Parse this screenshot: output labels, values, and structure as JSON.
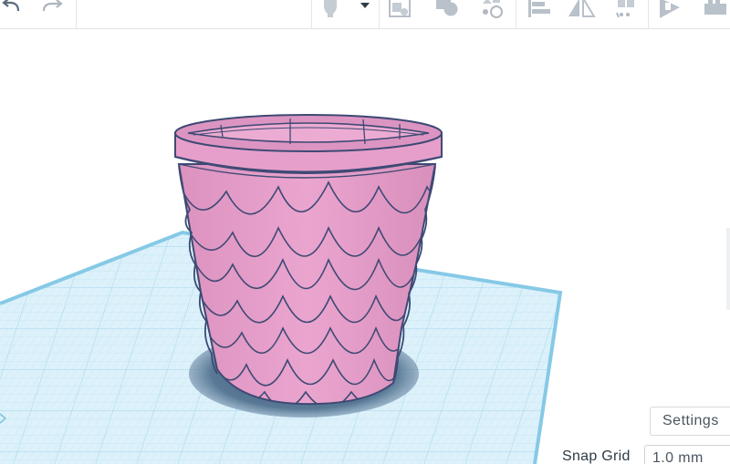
{
  "toolbar": {
    "icons": [
      "undo-icon",
      "redo-icon",
      "lightbulb-icon",
      "chevron-down-icon",
      "note-icon",
      "shape-union-icon",
      "shape-tools-icon",
      "align-icon",
      "mirror-icon",
      "group-icon",
      "export-icon",
      "cruise-icon"
    ]
  },
  "viewport": {
    "object_color": "#e79ec8",
    "object_stroke": "#3e4a74",
    "workplane_color": "#d6eef8",
    "workplane_border": "#93d0ea",
    "shadow_color": "#3f5f7e"
  },
  "settings": {
    "label": "Settings"
  },
  "snap_grid": {
    "label": "Snap Grid",
    "value": "1.0 mm"
  }
}
